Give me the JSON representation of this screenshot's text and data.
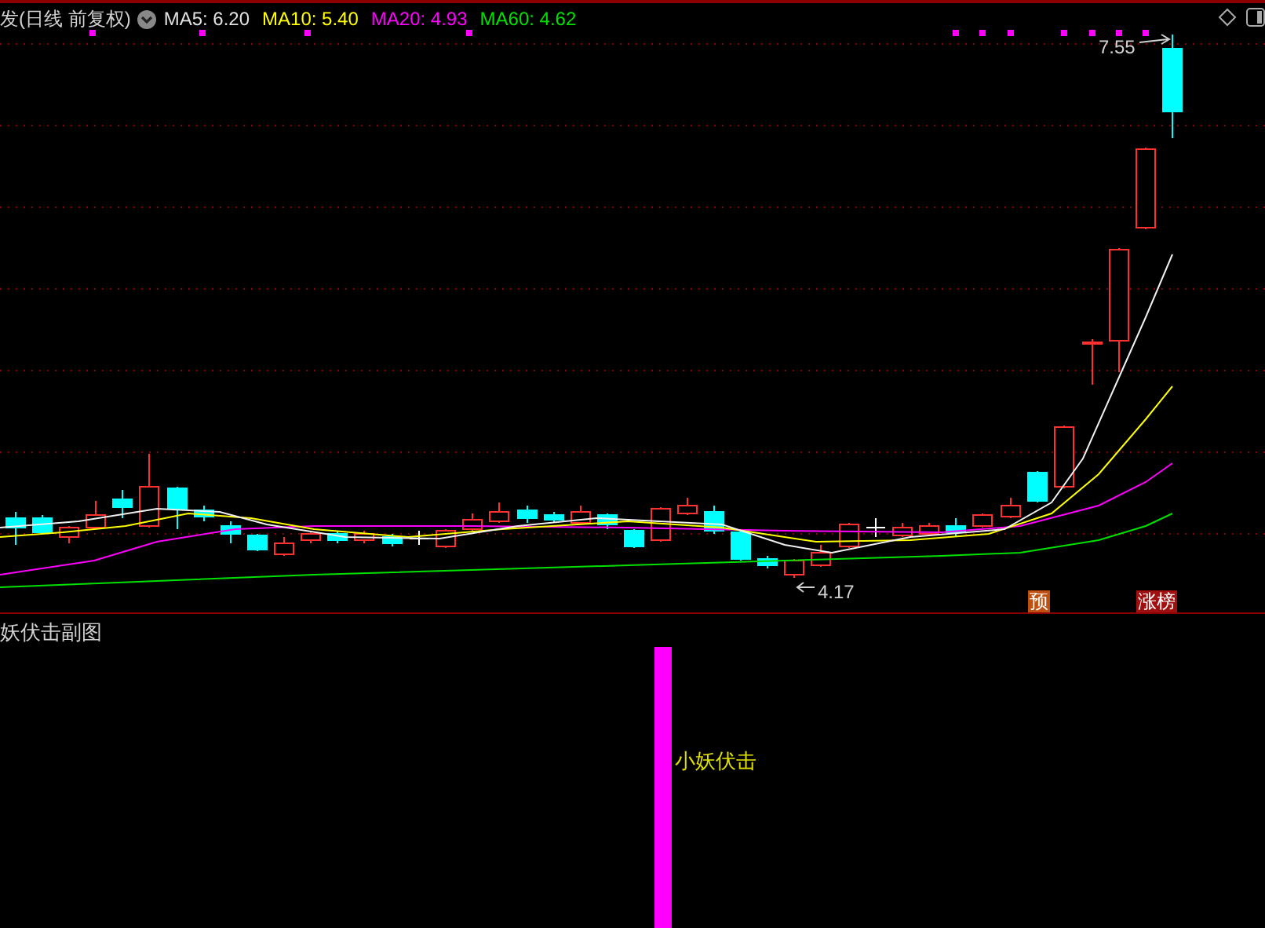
{
  "header": {
    "title": "发(日线 前复权)",
    "indicators": [
      {
        "label": "MA5:",
        "value": "6.20",
        "color": "#e0e0e0"
      },
      {
        "label": "MA10:",
        "value": "5.40",
        "color": "#ffff00"
      },
      {
        "label": "MA20:",
        "value": "4.93",
        "color": "#ff00ff"
      },
      {
        "label": "MA60:",
        "value": "4.62",
        "color": "#00e000"
      }
    ]
  },
  "main_chart": {
    "high_label": "7.55",
    "low_label": "4.17",
    "tags": [
      {
        "text": "预",
        "kind": "forecast"
      },
      {
        "text": "涨榜",
        "kind": "limit_up"
      }
    ]
  },
  "sub_chart": {
    "title": "妖伏击副图",
    "signal_label": "小妖伏击"
  }
}
